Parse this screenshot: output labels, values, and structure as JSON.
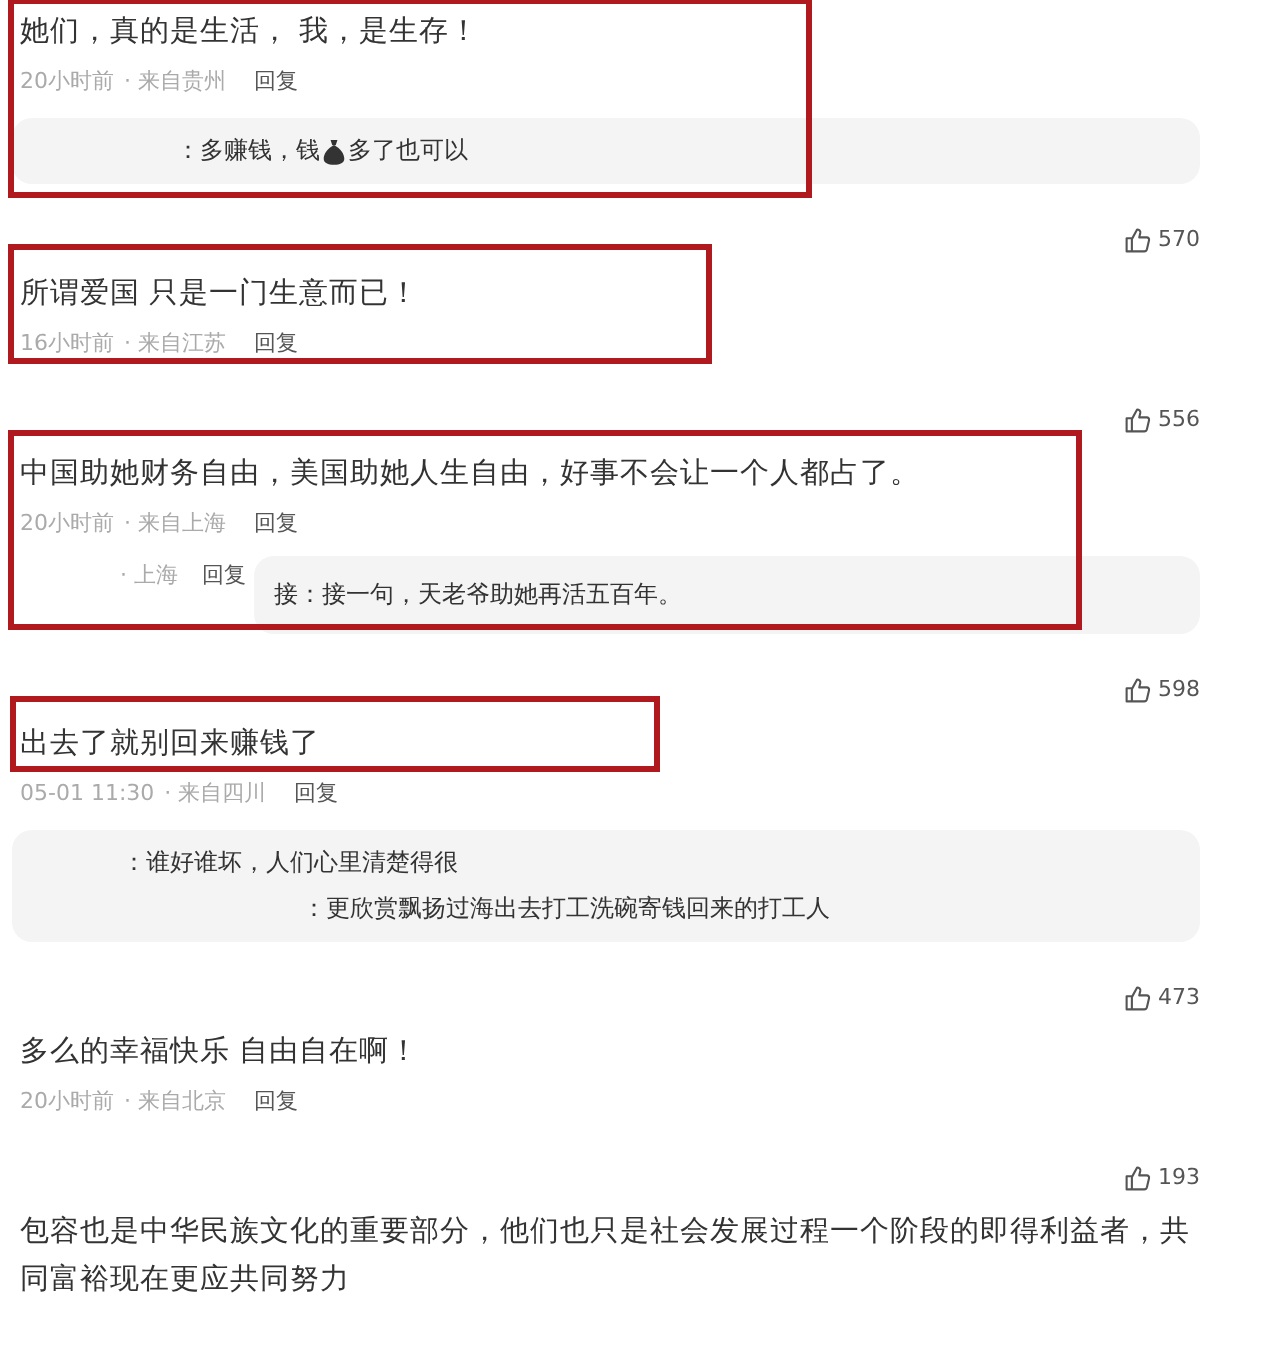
{
  "comments": [
    {
      "text": "她们，真的是生活， 我，是生存！",
      "time": "20小时前",
      "location": "· 来自贵州",
      "reply_action": "回复",
      "highlighted": true,
      "replies": {
        "kind": "box",
        "lines": [
          {
            "segments": [
              "：多赚钱，钱",
              "多了也可以"
            ]
          }
        ]
      }
    },
    {
      "likes": "570",
      "text": "所谓爱国 只是一门生意而已！",
      "time": "16小时前",
      "location": "· 来自江苏",
      "reply_action": "回复",
      "highlighted": true
    },
    {
      "likes": "556",
      "text": "中国助她财务自由，美国助她人生自由，好事不会让一个人都占了。",
      "time": "20小时前",
      "location": "· 来自上海",
      "reply_action": "回复",
      "highlighted": true,
      "replies": {
        "kind": "side",
        "location": "· 上海",
        "reply_action": "回复",
        "lines": [
          {
            "segments": [
              "接：接一句，天老爷助她再活五百年。"
            ]
          }
        ]
      }
    },
    {
      "likes": "598",
      "text": "出去了就别回来赚钱了",
      "time": "05-01 11:30",
      "location": "· 来自四川",
      "reply_action": "回复",
      "highlighted": true,
      "replies": {
        "kind": "box",
        "lines": [
          {
            "segments": [
              "：谁好谁坏，人们心里清楚得很"
            ]
          },
          {
            "segments": [
              "：更欣赏飘扬过海出去打工洗碗寄钱回来的打工人"
            ]
          }
        ]
      }
    },
    {
      "likes": "473",
      "text": "多么的幸福快乐 自由自在啊！",
      "time": "20小时前",
      "location": "· 来自北京",
      "reply_action": "回复"
    },
    {
      "likes": "193",
      "text": "包容也是中华民族文化的重要部分，他们也只是社会发展过程一个阶段的即得利益者，共同富裕现在更应共同努力"
    }
  ]
}
